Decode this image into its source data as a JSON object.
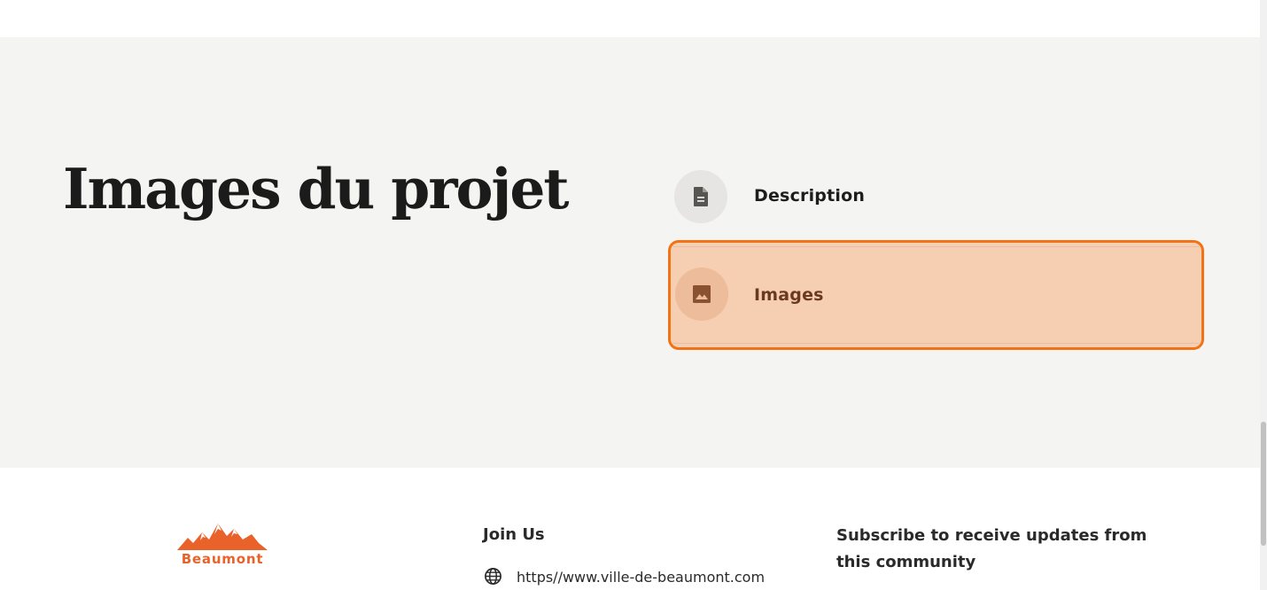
{
  "section": {
    "title": "Images du projet",
    "tabs": [
      {
        "label": "Description",
        "icon": "document-icon",
        "active": false
      },
      {
        "label": "Images",
        "icon": "image-icon",
        "active": true
      }
    ]
  },
  "footer": {
    "logo_text": "Beaumont",
    "join_heading": "Join Us",
    "website": "https//www.ville-de-beaumont.com",
    "subscribe_text": "Subscribe to receive updates from this community"
  },
  "colors": {
    "accent": "#f47216",
    "active_tab_bg": "#f6cfb2",
    "section_bg": "#f4f4f2",
    "logo": "#e8622a"
  }
}
